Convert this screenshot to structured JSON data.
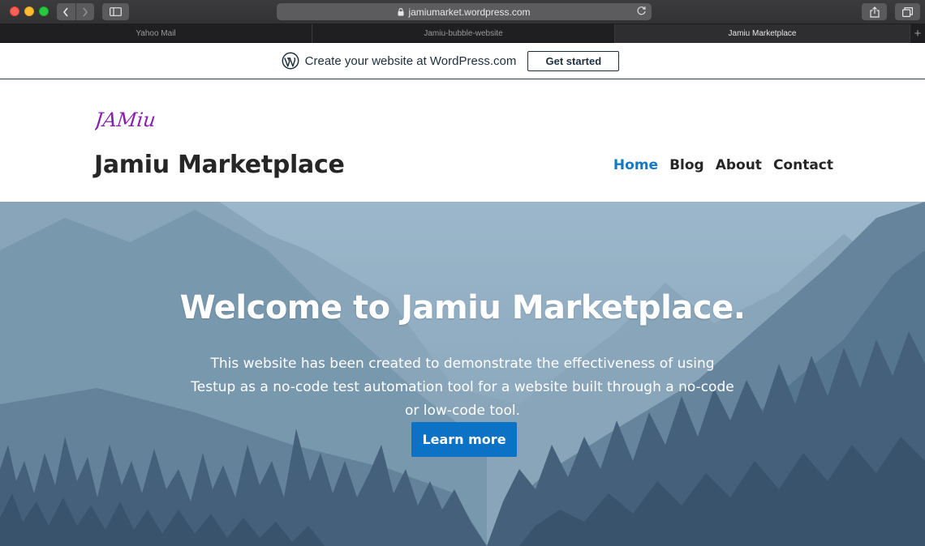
{
  "browser": {
    "url": "jamiumarket.wordpress.com",
    "tabs": [
      {
        "label": "Yahoo Mail",
        "active": false
      },
      {
        "label": "Jamiu-bubble-website",
        "active": false
      },
      {
        "label": "Jamiu Marketplace",
        "active": true
      }
    ],
    "new_tab_symbol": "+"
  },
  "promo": {
    "text": "Create your website at WordPress.com",
    "button_label": "Get started"
  },
  "site": {
    "logo_text": "JAMiu",
    "title": "Jamiu Marketplace",
    "nav": [
      {
        "label": "Home",
        "current": true
      },
      {
        "label": "Blog",
        "current": false
      },
      {
        "label": "About",
        "current": false
      },
      {
        "label": "Contact",
        "current": false
      }
    ]
  },
  "hero": {
    "title": "Welcome to Jamiu Marketplace.",
    "description": "This website has been created to demonstrate the effectiveness of using Testup as a no-code test automation tool for a website built through a no-code or low-code tool.",
    "button_label": "Learn more"
  },
  "colors": {
    "accent": "#1379c7",
    "button": "#0c72c6",
    "logo": "#8a1fb0",
    "promo_text": "#1d2f3d"
  },
  "icons": [
    "back-icon",
    "forward-icon",
    "sidebar-icon",
    "lock-icon",
    "reload-icon",
    "share-icon",
    "tabs-overview-icon",
    "wordpress-icon"
  ]
}
